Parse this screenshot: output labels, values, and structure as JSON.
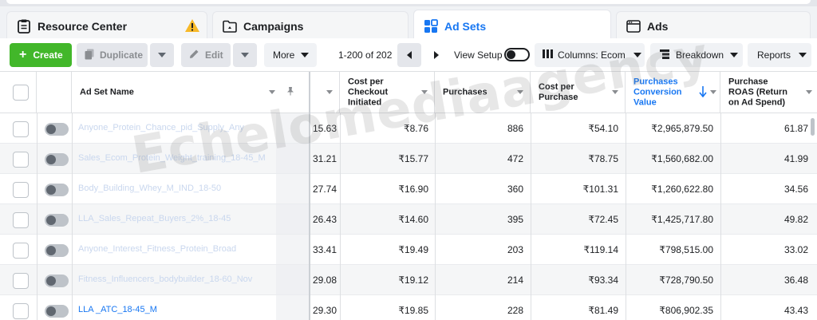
{
  "tabs": {
    "resource_center": "Resource Center",
    "campaigns": "Campaigns",
    "ad_sets": "Ad Sets",
    "ads": "Ads"
  },
  "toolbar": {
    "create_label": "Create",
    "duplicate_label": "Duplicate",
    "edit_label": "Edit",
    "more_label": "More",
    "pagination": "1-200 of 202",
    "view_setup_label": "View Setup",
    "view_setup_on": false,
    "columns_label": "Columns: Ecom",
    "breakdown_label": "Breakdown",
    "reports_label": "Reports"
  },
  "table": {
    "headers": {
      "name": "Ad Set Name",
      "cost_checkout_1": "Cost per",
      "cost_checkout_2": "Checkout",
      "cost_checkout_3": "Initiated",
      "purchases": "Purchases",
      "cost_purchase_1": "Cost per",
      "cost_purchase_2": "Purchase",
      "pcv_1": "Purchases",
      "pcv_2": "Conversion",
      "pcv_3": "Value",
      "roas_1": "Purchase",
      "roas_2": "ROAS (Return",
      "roas_3": "on Ad Spend)"
    },
    "rows": [
      {
        "name": "Anyone_Protein_Chance_pid_Supply_Any",
        "partial": "15.63",
        "cost_checkout": "₹8.76",
        "purchases": "886",
        "cost_purchase": "₹54.10",
        "pcv": "₹2,965,879.50",
        "roas": "61.87"
      },
      {
        "name": "Sales_Ecom_Protein_Weight_training_18-45_M",
        "partial": "31.21",
        "cost_checkout": "₹15.77",
        "purchases": "472",
        "cost_purchase": "₹78.75",
        "pcv": "₹1,560,682.00",
        "roas": "41.99"
      },
      {
        "name": "Body_Building_Whey_M_IND_18-50",
        "partial": "27.74",
        "cost_checkout": "₹16.90",
        "purchases": "360",
        "cost_purchase": "₹101.31",
        "pcv": "₹1,260,622.80",
        "roas": "34.56"
      },
      {
        "name": "LLA_Sales_Repeat_Buyers_2%_18-45",
        "partial": "26.43",
        "cost_checkout": "₹14.60",
        "purchases": "395",
        "cost_purchase": "₹72.45",
        "pcv": "₹1,425,717.80",
        "roas": "49.82"
      },
      {
        "name": "Anyone_Interest_Fitness_Protein_Broad",
        "partial": "33.41",
        "cost_checkout": "₹19.49",
        "purchases": "203",
        "cost_purchase": "₹119.14",
        "pcv": "₹798,515.00",
        "roas": "33.02"
      },
      {
        "name": "Fitness_Influencers_bodybuilder_18-60_Nov",
        "partial": "29.08",
        "cost_checkout": "₹19.12",
        "purchases": "214",
        "cost_purchase": "₹93.34",
        "pcv": "₹728,790.50",
        "roas": "36.48"
      },
      {
        "name": "LLA _ATC_18-45_M",
        "partial": "29.30",
        "cost_checkout": "₹19.85",
        "purchases": "228",
        "cost_purchase": "₹81.49",
        "pcv": "₹806,902.35",
        "roas": "43.43"
      }
    ]
  },
  "watermark": "Echelomediaagency",
  "colors": {
    "accent": "#1877f2",
    "create": "#42b72a",
    "warning": "#f7b928"
  }
}
